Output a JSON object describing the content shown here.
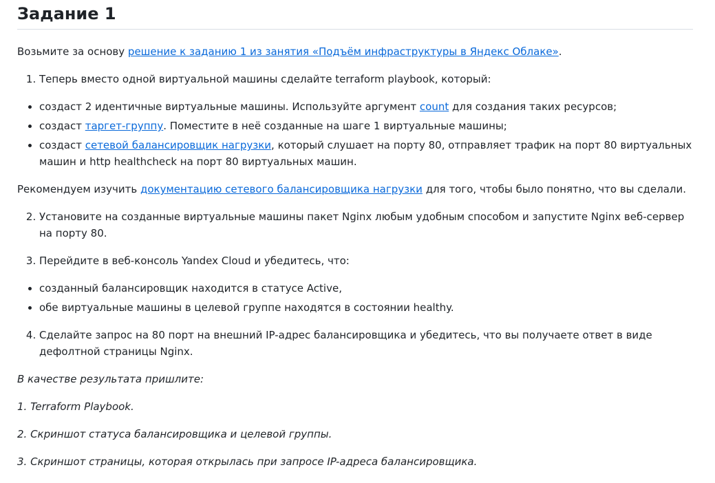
{
  "heading": "Задание 1",
  "intro": {
    "prefix": "Возьмите за основу ",
    "link": "решение к заданию 1 из занятия «Подъём инфраструктуры в Яндекс Облаке»",
    "suffix": "."
  },
  "step1": {
    "number": "1",
    "text": "Теперь вместо одной виртуальной машины сделайте terraform playbook, который:"
  },
  "step1_bullets": {
    "b1_prefix": "создаст 2 идентичные виртуальные машины. Используйте аргумент ",
    "b1_link": "count",
    "b1_suffix": " для создания таких ресурсов;",
    "b2_prefix": "создаст ",
    "b2_link": "таргет-группу",
    "b2_suffix": ". Поместите в неё созданные на шаге 1 виртуальные машины;",
    "b3_prefix": "создаст ",
    "b3_link": "сетевой балансировщик нагрузки",
    "b3_suffix": ", который слушает на порту 80, отправляет трафик на порт 80 виртуальных машин и http healthcheck на порт 80 виртуальных машин."
  },
  "recommend": {
    "prefix": "Рекомендуем изучить ",
    "link": "документацию сетевого балансировщика нагрузки",
    "suffix": " для того, чтобы было понятно, что вы сделали."
  },
  "step2": {
    "number": "2",
    "text": "Установите на созданные виртуальные машины пакет Nginx любым удобным способом и запустите Nginx веб-сервер на порту 80."
  },
  "step3": {
    "number": "3",
    "text": "Перейдите в веб-консоль Yandex Cloud и убедитесь, что:"
  },
  "step3_bullets": {
    "b1": "созданный балансировщик находится в статусе Active,",
    "b2": "обе виртуальные машины в целевой группе находятся в состоянии healthy."
  },
  "step4": {
    "number": "4",
    "text": "Сделайте запрос на 80 порт на внешний IP-адрес балансировщика и убедитесь, что вы получаете ответ в виде дефолтной страницы Nginx."
  },
  "result": {
    "title": "В качестве результата пришлите:",
    "r1": "1. Terraform Playbook.",
    "r2": "2. Скриншот статуса балансировщика и целевой группы.",
    "r3": "3. Скриншот страницы, которая открылась при запросе IP-адреса балансировщика."
  }
}
